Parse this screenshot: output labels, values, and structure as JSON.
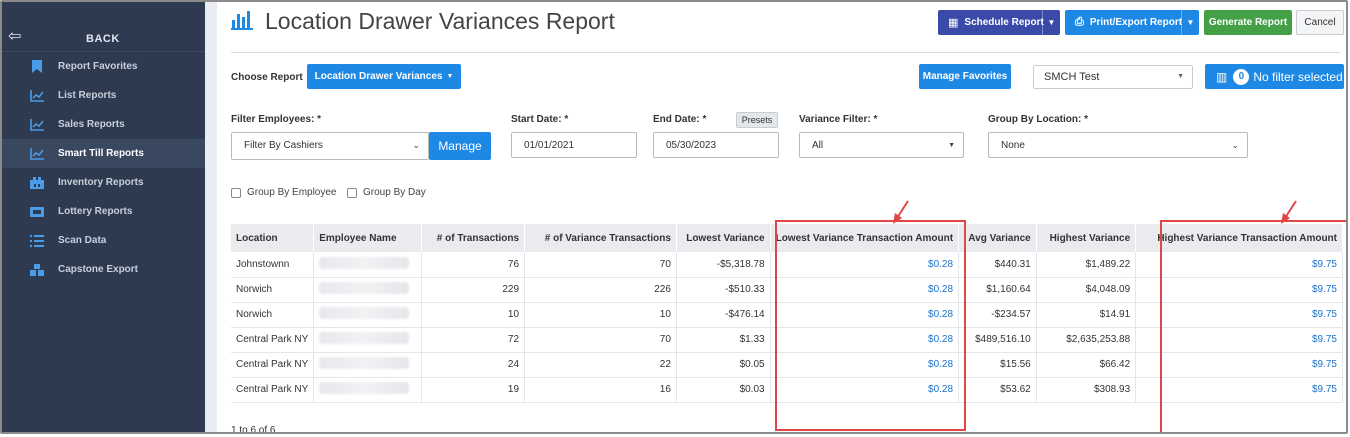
{
  "sidebar": {
    "back_label": "BACK",
    "items": [
      {
        "label": "Report Favorites",
        "icon": "bookmark-icon",
        "active": false
      },
      {
        "label": "List Reports",
        "icon": "line-chart-icon",
        "active": false
      },
      {
        "label": "Sales Reports",
        "icon": "line-chart-icon",
        "active": false
      },
      {
        "label": "Smart Till Reports",
        "icon": "line-chart-icon",
        "active": true
      },
      {
        "label": "Inventory Reports",
        "icon": "warehouse-icon",
        "active": false
      },
      {
        "label": "Lottery Reports",
        "icon": "ticket-icon",
        "active": false
      },
      {
        "label": "Scan Data",
        "icon": "list-icon",
        "active": false
      },
      {
        "label": "Capstone Export",
        "icon": "cubes-icon",
        "active": false
      }
    ]
  },
  "header": {
    "title": "Location Drawer Variances Report",
    "schedule_label": "Schedule Report",
    "print_label": "Print/Export Report",
    "generate_label": "Generate Report",
    "cancel_label": "Cancel"
  },
  "controls": {
    "choose_label": "Choose Report",
    "choose_value": "Location Drawer Variances",
    "manage_favorites": "Manage Favorites",
    "store_value": "SMCH Test",
    "filter_count": "0",
    "filter_label": "No filter selected"
  },
  "filters": {
    "employees_label": "Filter Employees: *",
    "employees_value": "Filter By Cashiers",
    "manage_label": "Manage",
    "start_label": "Start Date: *",
    "start_value": "01/01/2021",
    "end_label": "End Date: *",
    "end_value": "05/30/2023",
    "presets_label": "Presets",
    "variance_label": "Variance Filter: *",
    "variance_value": "All",
    "group_location_label": "Group By Location: *",
    "group_location_value": "None",
    "group_employee_label": "Group By Employee",
    "group_day_label": "Group By Day"
  },
  "table": {
    "columns": [
      "Location",
      "Employee Name",
      "# of Transactions",
      "# of Variance Transactions",
      "Lowest Variance",
      "Lowest Variance Transaction Amount",
      "Avg Variance",
      "Highest Variance",
      "Highest Variance Transaction Amount"
    ],
    "rows": [
      [
        "Johnstownn",
        "",
        "76",
        "70",
        "-$5,318.78",
        "$0.28",
        "$440.31",
        "$1,489.22",
        "$9.75"
      ],
      [
        "Norwich",
        "",
        "229",
        "226",
        "-$510.33",
        "$0.28",
        "$1,160.64",
        "$4,048.09",
        "$9.75"
      ],
      [
        "Norwich",
        "",
        "10",
        "10",
        "-$476.14",
        "$0.28",
        "-$234.57",
        "$14.91",
        "$9.75"
      ],
      [
        "Central Park NY",
        "",
        "72",
        "70",
        "$1.33",
        "$0.28",
        "$489,516.10",
        "$2,635,253.88",
        "$9.75"
      ],
      [
        "Central Park NY",
        "",
        "24",
        "22",
        "$0.05",
        "$0.28",
        "$15.56",
        "$66.42",
        "$9.75"
      ],
      [
        "Central Park NY",
        "",
        "19",
        "16",
        "$0.03",
        "$0.28",
        "$53.62",
        "$308.93",
        "$9.75"
      ]
    ],
    "footer": "1 to 6 of 6"
  },
  "colors": {
    "sidebar_bg": "#2d3a4f",
    "primary": "#1e88e5",
    "schedule": "#3b4aa8",
    "generate": "#43a047",
    "highlight": "#e04646"
  }
}
